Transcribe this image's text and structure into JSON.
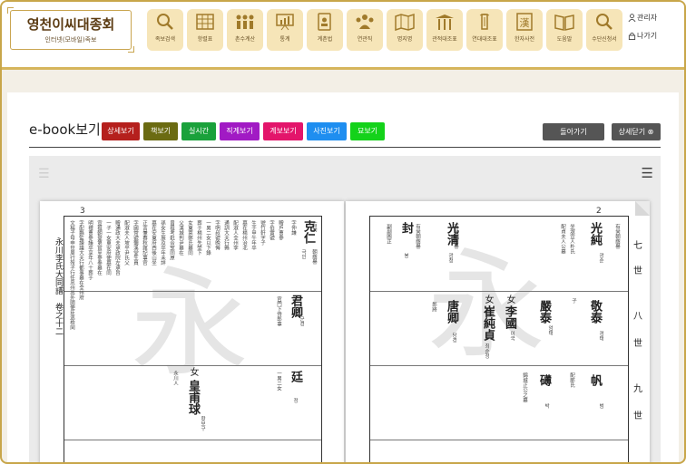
{
  "header": {
    "logo_title": "영천이씨대종회",
    "logo_sub": "인터넷(모바일)족보",
    "nav": [
      {
        "label": "족보검색",
        "icon": "search-icon"
      },
      {
        "label": "항렬표",
        "icon": "table-icon"
      },
      {
        "label": "촌수계산",
        "icon": "people-icon"
      },
      {
        "label": "통계",
        "icon": "chart-board-icon"
      },
      {
        "label": "계촌법",
        "icon": "document-person-icon"
      },
      {
        "label": "연관직",
        "icon": "group-icon"
      },
      {
        "label": "명지명",
        "icon": "map-icon"
      },
      {
        "label": "관적대조표",
        "icon": "gate-icon"
      },
      {
        "label": "연대대조표",
        "icon": "scroll-icon"
      },
      {
        "label": "한자사전",
        "icon": "hanja-icon"
      },
      {
        "label": "도움말",
        "icon": "book-icon"
      },
      {
        "label": "수단신청서",
        "icon": "search-icon"
      }
    ],
    "admin_label": "관리자",
    "logout_label": "나가기"
  },
  "viewer": {
    "title": "e-book보기",
    "tabs": [
      {
        "label": "상세보기",
        "color": "#b5201d"
      },
      {
        "label": "책보기",
        "color": "#6b6b12"
      },
      {
        "label": "실시간",
        "color": "#1aa13b"
      },
      {
        "label": "직계보기",
        "color": "#a11ac4"
      },
      {
        "label": "계보보기",
        "color": "#e3156b"
      },
      {
        "label": "사진보기",
        "color": "#1e8ef0"
      },
      {
        "label": "묘보기",
        "color": "#14d21a"
      }
    ],
    "back_label": "돌아가기",
    "close_detail_label": "상세닫기 ⊗"
  },
  "book": {
    "left_page_number": "3",
    "right_page_number": "2",
    "left_spine_text": "永川李氏大同譜　卷之十二",
    "right_generations": [
      "七",
      "世",
      "八",
      "世",
      "九",
      "世"
    ],
    "watermark": "永",
    "left_entries": [
      {
        "name": "克仁",
        "reading": "극인"
      },
      {
        "name": "君卿",
        "reading": "군경"
      },
      {
        "name": "廷",
        "reading": "정"
      },
      {
        "name": "皇甫球",
        "prefix": "女",
        "reading": "황보구"
      }
    ],
    "right_entries": [
      {
        "name": "封",
        "reading": "봉"
      },
      {
        "name": "光清",
        "reading": "광청"
      },
      {
        "name": "光純",
        "reading": "광순"
      },
      {
        "name": "唐卿",
        "reading": "당경"
      },
      {
        "name": "崔純貞",
        "prefix": "女",
        "reading": "최순정"
      },
      {
        "name": "李國",
        "prefix": "女",
        "reading": "이국"
      },
      {
        "name": "嚴泰",
        "reading": "엄태"
      },
      {
        "name": "敬泰",
        "reading": "경태"
      },
      {
        "name": "礡",
        "reading": "박"
      },
      {
        "name": "帆",
        "reading": "범"
      }
    ]
  }
}
